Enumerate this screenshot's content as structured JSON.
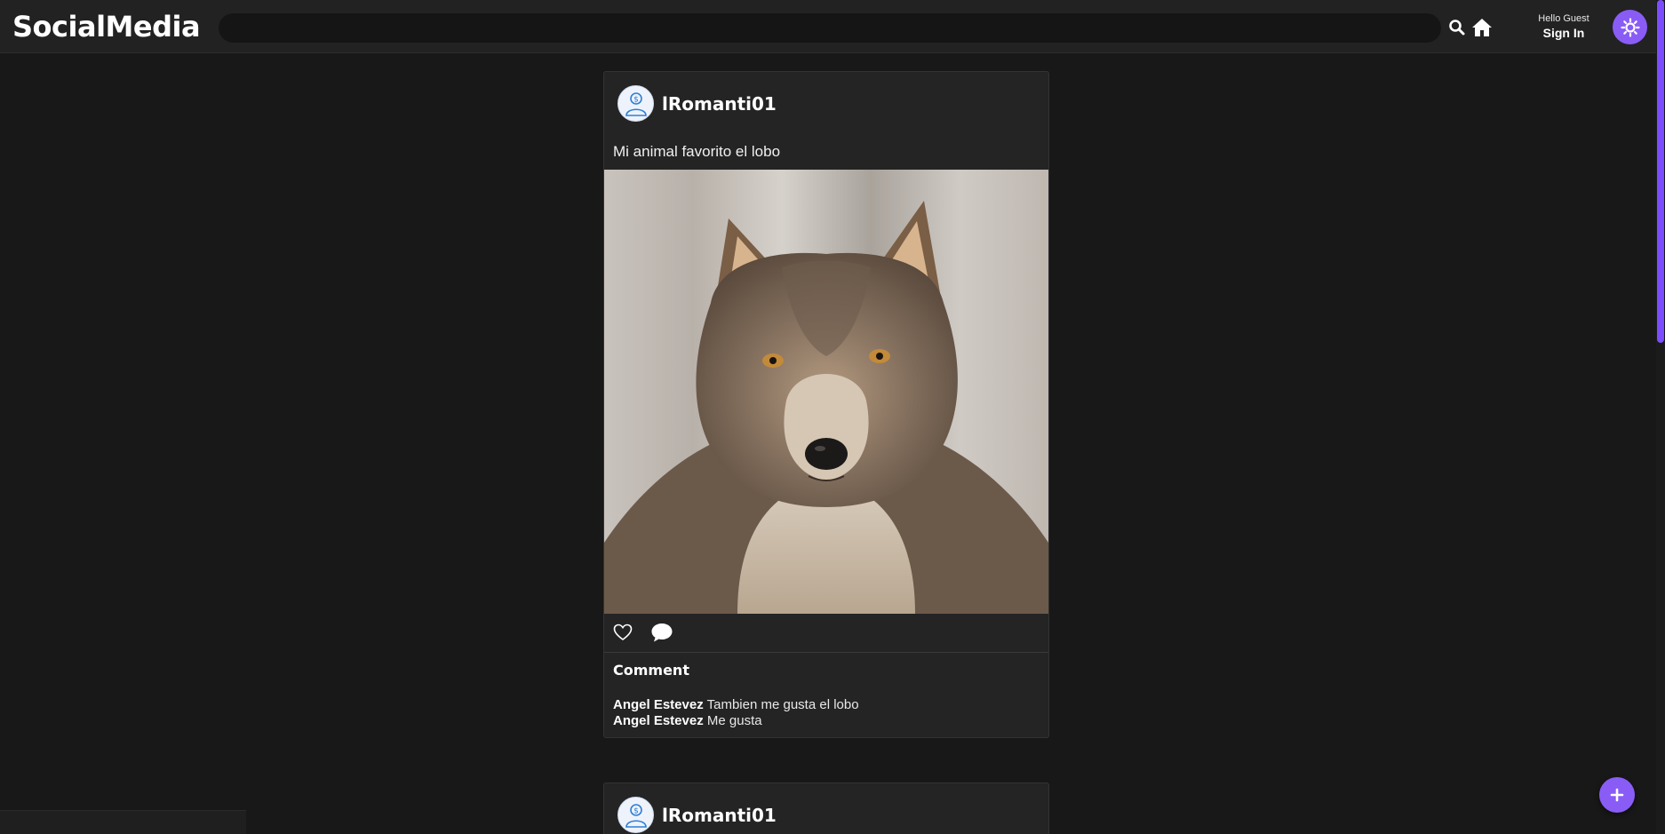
{
  "header": {
    "logo": "SocialMedia",
    "search_placeholder": "",
    "greeting": "Hello Guest",
    "signin_label": "Sign In"
  },
  "colors": {
    "accent": "#8a5cf6",
    "background": "#181818",
    "card": "#242424",
    "topbar": "#222222"
  },
  "icons": {
    "search": "search-icon",
    "home": "home-icon",
    "theme": "sun-icon",
    "like": "heart-icon",
    "comment": "comment-bubble-icon",
    "add": "plus-icon",
    "avatar": "user-avatar-icon"
  },
  "posts": [
    {
      "username": "lRomanti01",
      "caption": "Mi animal favorito el lobo",
      "image_alt": "wolf-photo",
      "comments_heading": "Comment",
      "comments": [
        {
          "author": "Angel Estevez",
          "text": "Tambien me gusta el lobo"
        },
        {
          "author": "Angel Estevez",
          "text": "Me gusta"
        }
      ]
    },
    {
      "username": "lRomanti01"
    }
  ]
}
